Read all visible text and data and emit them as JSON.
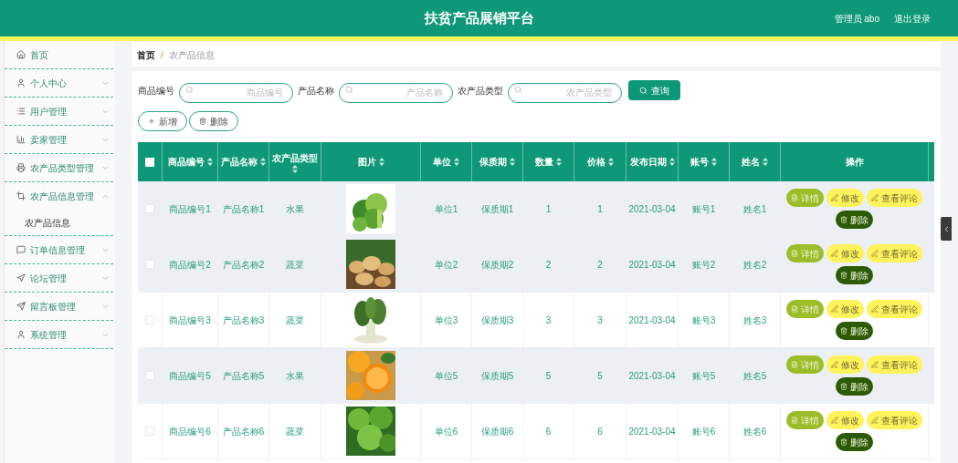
{
  "header": {
    "title": "扶贫产品展销平台",
    "user": "管理员 abo",
    "logout": "退出登录"
  },
  "sidebar": {
    "items": [
      {
        "label": "首页"
      },
      {
        "label": "个人中心",
        "expanded": false
      },
      {
        "label": "用户管理",
        "expanded": false
      },
      {
        "label": "卖家管理",
        "expanded": false
      },
      {
        "label": "农产品类型管理",
        "expanded": false
      },
      {
        "label": "农产品信息管理",
        "expanded": true,
        "children": [
          {
            "label": "农产品信息"
          }
        ]
      },
      {
        "label": "订单信息管理",
        "expanded": false
      },
      {
        "label": "论坛管理",
        "expanded": false
      },
      {
        "label": "留言板管理",
        "expanded": false
      },
      {
        "label": "系统管理",
        "expanded": false
      }
    ]
  },
  "breadcrumb": [
    "首页",
    "农产品信息"
  ],
  "breadcrumb_separator": "/",
  "search": {
    "fields": [
      {
        "label": "商品编号",
        "placeholder": "商品编号"
      },
      {
        "label": "产品名称",
        "placeholder": "产品名称"
      },
      {
        "label": "农产品类型",
        "placeholder": "农产品类型"
      }
    ],
    "button": "查询"
  },
  "actions": [
    "新增",
    "删除"
  ],
  "table": {
    "columns": [
      {
        "label": "商品编号",
        "sortable": true
      },
      {
        "label": "产品名称",
        "sortable": true
      },
      {
        "label": "农产品类型",
        "sortable": true
      },
      {
        "label": "图片",
        "sortable": true
      },
      {
        "label": "单位",
        "sortable": true
      },
      {
        "label": "保质期",
        "sortable": true
      },
      {
        "label": "数量",
        "sortable": true
      },
      {
        "label": "价格",
        "sortable": true
      },
      {
        "label": "发布日期",
        "sortable": true
      },
      {
        "label": "账号",
        "sortable": true
      },
      {
        "label": "姓名",
        "sortable": true
      },
      {
        "label": "操作",
        "sortable": false
      }
    ],
    "select_all_checked": false,
    "rows": [
      {
        "checked": false,
        "shaded": true,
        "cells": [
          "商品编号1",
          "产品名称1",
          "水果",
          {
            "kind": "picture"
          },
          "单位1",
          "保质期1",
          "1",
          "1",
          "2021-03-04",
          "账号1",
          "姓名1",
          {
            "kind": "actions",
            "buttons": [
              {
                "label": "详情",
                "kind": "detail"
              },
              {
                "label": "修改",
                "kind": "edit"
              },
              {
                "label": "查看评论",
                "kind": "comments"
              },
              {
                "label": "删除",
                "kind": "delete"
              }
            ]
          }
        ]
      },
      {
        "checked": false,
        "shaded": true,
        "cells": [
          "商品编号2",
          "产品名称2",
          "蔬菜",
          {
            "kind": "picture"
          },
          "单位2",
          "保质期2",
          "2",
          "2",
          "2021-03-04",
          "账号2",
          "姓名2",
          {
            "kind": "actions",
            "buttons": [
              {
                "label": "详情",
                "kind": "detail"
              },
              {
                "label": "修改",
                "kind": "edit"
              },
              {
                "label": "查看评论",
                "kind": "comments"
              },
              {
                "label": "删除",
                "kind": "delete"
              }
            ]
          }
        ]
      },
      {
        "checked": false,
        "shaded": false,
        "cells": [
          "商品编号3",
          "产品名称3",
          "蔬菜",
          {
            "kind": "picture"
          },
          "单位3",
          "保质期3",
          "3",
          "3",
          "2021-03-04",
          "账号3",
          "姓名3",
          {
            "kind": "actions",
            "buttons": [
              {
                "label": "详情",
                "kind": "detail"
              },
              {
                "label": "修改",
                "kind": "edit"
              },
              {
                "label": "查看评论",
                "kind": "comments"
              },
              {
                "label": "删除",
                "kind": "delete"
              }
            ]
          }
        ]
      },
      {
        "checked": false,
        "shaded": true,
        "cells": [
          "商品编号5",
          "产品名称5",
          "水果",
          {
            "kind": "picture"
          },
          "单位5",
          "保质期5",
          "5",
          "5",
          "2021-03-04",
          "账号5",
          "姓名5",
          {
            "kind": "actions",
            "buttons": [
              {
                "label": "详情",
                "kind": "detail"
              },
              {
                "label": "修改",
                "kind": "edit"
              },
              {
                "label": "查看评论",
                "kind": "comments"
              },
              {
                "label": "删除",
                "kind": "delete"
              }
            ]
          }
        ]
      },
      {
        "checked": false,
        "shaded": false,
        "cells": [
          "商品编号6",
          "产品名称6",
          "蔬菜",
          {
            "kind": "picture"
          },
          "单位6",
          "保质期6",
          "6",
          "6",
          "2021-03-04",
          "账号6",
          "姓名6",
          {
            "kind": "actions",
            "buttons": [
              {
                "label": "详情",
                "kind": "detail"
              },
              {
                "label": "修改",
                "kind": "edit"
              },
              {
                "label": "查看评论",
                "kind": "comments"
              },
              {
                "label": "删除",
                "kind": "delete"
              }
            ]
          }
        ]
      }
    ]
  }
}
